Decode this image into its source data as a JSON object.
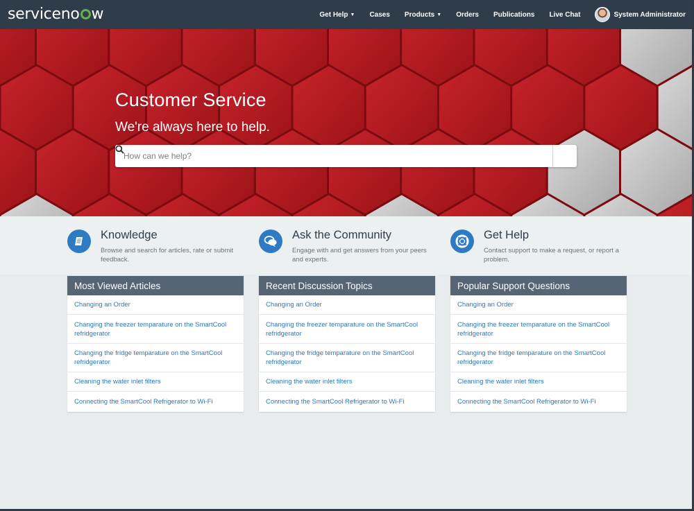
{
  "brand": {
    "logo_prefix": "service",
    "logo_suffix": "w"
  },
  "nav": {
    "items": [
      {
        "label": "Get Help",
        "dropdown": true
      },
      {
        "label": "Cases",
        "dropdown": false
      },
      {
        "label": "Products",
        "dropdown": true
      },
      {
        "label": "Orders",
        "dropdown": false
      },
      {
        "label": "Publications",
        "dropdown": false
      },
      {
        "label": "Live Chat",
        "dropdown": false
      }
    ],
    "user_name": "System Administrator",
    "caret_glyph": "▼"
  },
  "hero": {
    "title": "Customer Service",
    "subtitle": "We're always here to help.",
    "search_placeholder": "How can we help?"
  },
  "features": [
    {
      "icon": "book-icon",
      "title": "Knowledge",
      "description": "Browse and search for articles, rate or submit feedback."
    },
    {
      "icon": "chat-bubbles-icon",
      "title": "Ask the Community",
      "description": "Engage with and get answers from your peers and experts."
    },
    {
      "icon": "lifebuoy-icon",
      "title": "Get Help",
      "description": "Contact support to make a request, or report a problem."
    }
  ],
  "panels": [
    {
      "title": "Most Viewed Articles",
      "links": [
        "Changing an Order",
        "Changing the freezer temparature on the SmartCool refridgerator",
        "Changing the fridge temparature on the SmartCool refridgerator",
        "Cleaning the water inlet filters",
        "Connecting the SmartCool Refrigerator to Wi-Fi"
      ]
    },
    {
      "title": "Recent Discussion Topics",
      "links": [
        "Changing an Order",
        "Changing the freezer temparature on the SmartCool refridgerator",
        "Changing the fridge temparature on the SmartCool refridgerator",
        "Cleaning the water inlet filters",
        "Connecting the SmartCool Refrigerator to Wi-Fi"
      ]
    },
    {
      "title": "Popular Support Questions",
      "links": [
        "Changing an Order",
        "Changing the freezer temparature on the SmartCool refridgerator",
        "Changing the fridge temparature on the SmartCool refridgerator",
        "Cleaning the water inlet filters",
        "Connecting the SmartCool Refrigerator to Wi-Fi"
      ]
    }
  ],
  "colors": {
    "navbar": "#2e3d49",
    "accent_blue": "#2f7bc3",
    "panel_header": "#566576",
    "link": "#2f78bb",
    "hero_red": "#b3171f",
    "logo_green": "#6ab04c"
  }
}
